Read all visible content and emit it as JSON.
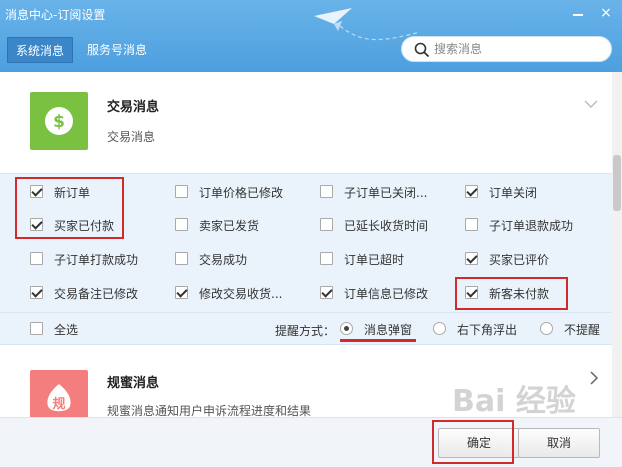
{
  "window": {
    "title": "消息中心-订阅设置",
    "close_glyph": "×"
  },
  "tabs": [
    {
      "label": "系统消息",
      "active": true
    },
    {
      "label": "服务号消息",
      "active": false
    }
  ],
  "search": {
    "placeholder": "搜索消息",
    "value": ""
  },
  "sections": [
    {
      "title": "交易消息",
      "subtitle": "交易消息",
      "icon_color": "#7ac142",
      "icon": "dollar-icon",
      "expanded": true
    },
    {
      "title": "规蜜消息",
      "subtitle": "规蜜消息通知用户申诉流程进度和结果",
      "icon_color": "#f47d7d",
      "icon_text": "规",
      "icon": "guimi-icon",
      "expanded": false
    }
  ],
  "options": [
    {
      "label": "新订单",
      "checked": true
    },
    {
      "label": "订单价格已修改",
      "checked": false
    },
    {
      "label": "子订单已关闭...",
      "checked": false
    },
    {
      "label": "订单关闭",
      "checked": true
    },
    {
      "label": "买家已付款",
      "checked": true
    },
    {
      "label": "卖家已发货",
      "checked": false
    },
    {
      "label": "已延长收货时间",
      "checked": false
    },
    {
      "label": "子订单退款成功",
      "checked": false
    },
    {
      "label": "子订单打款成功",
      "checked": false
    },
    {
      "label": "交易成功",
      "checked": false
    },
    {
      "label": "订单已超时",
      "checked": false
    },
    {
      "label": "买家已评价",
      "checked": true
    },
    {
      "label": "交易备注已修改",
      "checked": true
    },
    {
      "label": "修改交易收货...",
      "checked": true
    },
    {
      "label": "订单信息已修改",
      "checked": true
    },
    {
      "label": "新客未付款",
      "checked": true
    }
  ],
  "select_all": {
    "label": "全选",
    "checked": false
  },
  "remind": {
    "label": "提醒方式：",
    "options": [
      {
        "label": "消息弹窗",
        "selected": true
      },
      {
        "label": "右下角浮出",
        "selected": false
      },
      {
        "label": "不提醒",
        "selected": false
      }
    ]
  },
  "buttons": {
    "confirm": "确定",
    "cancel": "取消"
  },
  "watermark": "Bai 经验",
  "colors": {
    "accent": "#4d9fdf",
    "highlight": "#d22a2a"
  }
}
